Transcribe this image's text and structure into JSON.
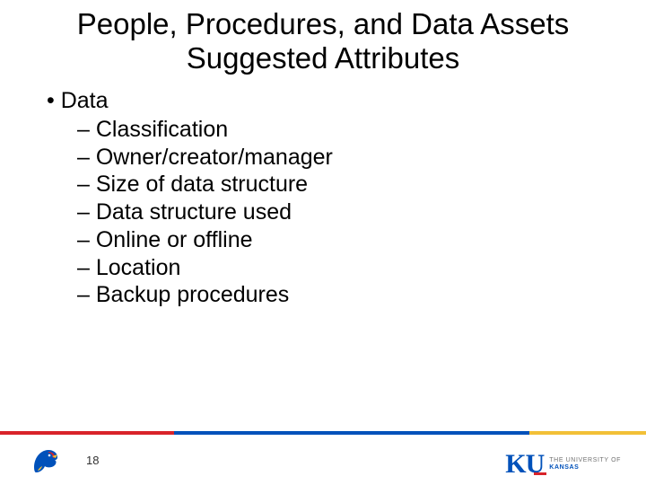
{
  "title_line1": "People, Procedures, and Data Assets",
  "title_line2": "Suggested Attributes",
  "bullet1": "Data",
  "sub_items": [
    "Classification",
    "Owner/creator/manager",
    "Size of data structure",
    "Data structure used",
    "Online or offline",
    "Location",
    "Backup procedures"
  ],
  "page_number": "18",
  "ku_mark": "KU",
  "ku_tag1": "THE UNIVERSITY OF",
  "ku_tag2": "KANSAS"
}
